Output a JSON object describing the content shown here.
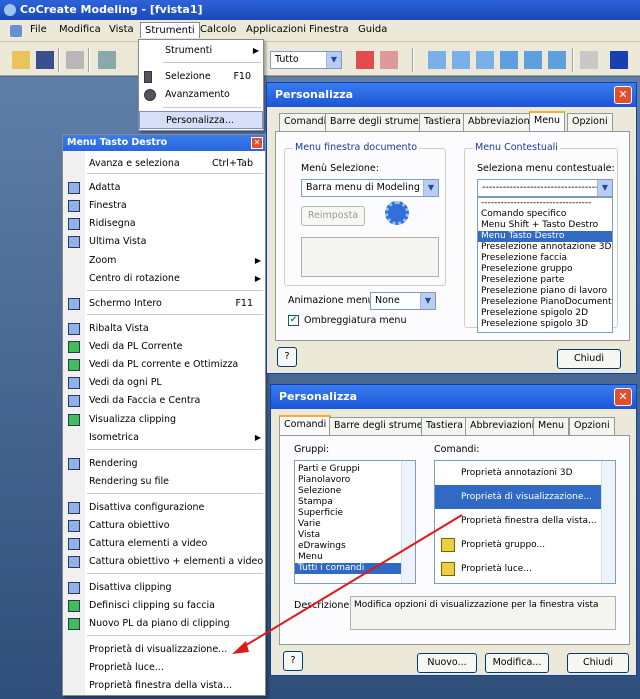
{
  "app": {
    "title": "CoCreate Modeling - [fvista1]"
  },
  "menubar": [
    "File",
    "Modifica",
    "Vista",
    "Strumenti",
    "Calcolo",
    "Applicazioni",
    "Finestra",
    "Guida"
  ],
  "toolbar": {
    "filter_value": "Tutto"
  },
  "strumenti_menu": {
    "items": [
      {
        "label": "Strumenti",
        "shortcut": "",
        "submenu": true
      },
      {
        "label": "Selezione",
        "shortcut": "F10",
        "submenu": false
      },
      {
        "label": "Avanzamento",
        "shortcut": "",
        "submenu": false
      },
      {
        "label": "Personalizza...",
        "shortcut": "",
        "submenu": false
      }
    ]
  },
  "context_menu": {
    "title": "Menu Tasto Destro",
    "items": [
      {
        "label": "Avanza e seleziona",
        "shortcut": "Ctrl+Tab"
      },
      {
        "label": "Adatta",
        "shortcut": ""
      },
      {
        "label": "Finestra",
        "shortcut": ""
      },
      {
        "label": "Ridisegna",
        "shortcut": ""
      },
      {
        "label": "Ultima Vista",
        "shortcut": ""
      },
      {
        "label": "Zoom",
        "shortcut": ""
      },
      {
        "label": "Centro di rotazione",
        "shortcut": ""
      },
      {
        "label": "Schermo Intero",
        "shortcut": "F11"
      },
      {
        "label": "Ribalta Vista",
        "shortcut": ""
      },
      {
        "label": "Vedi da PL Corrente",
        "shortcut": ""
      },
      {
        "label": "Vedi da PL corrente e Ottimizza",
        "shortcut": ""
      },
      {
        "label": "Vedi da ogni PL",
        "shortcut": ""
      },
      {
        "label": "Vedi da Faccia e Centra",
        "shortcut": ""
      },
      {
        "label": "Visualizza clipping",
        "shortcut": ""
      },
      {
        "label": "Isometrica",
        "shortcut": ""
      },
      {
        "label": "Rendering",
        "shortcut": ""
      },
      {
        "label": "Rendering su file",
        "shortcut": ""
      },
      {
        "label": "Disattiva configurazione",
        "shortcut": ""
      },
      {
        "label": "Cattura obiettivo",
        "shortcut": ""
      },
      {
        "label": "Cattura elementi a video",
        "shortcut": ""
      },
      {
        "label": "Cattura obiettivo + elementi a video",
        "shortcut": ""
      },
      {
        "label": "Disattiva clipping",
        "shortcut": ""
      },
      {
        "label": "Definisci clipping su faccia",
        "shortcut": ""
      },
      {
        "label": "Nuovo PL da piano di clipping",
        "shortcut": ""
      },
      {
        "label": "Proprietà di visualizzazione...",
        "shortcut": ""
      },
      {
        "label": "Proprietà luce...",
        "shortcut": ""
      },
      {
        "label": "Proprietà finestra della vista...",
        "shortcut": ""
      }
    ]
  },
  "dialog1": {
    "title": "Personalizza",
    "tabs": [
      "Comandi",
      "Barre degli strumenti",
      "Tastiera",
      "Abbreviazioni",
      "Menu",
      "Opzioni"
    ],
    "group_left": "Menu finestra documento",
    "menu_sel_label": "Menù Selezione:",
    "menu_sel_value": "Barra menu di Modeling",
    "reset_button": "Reimposta",
    "group_right": "Menu Contestuali",
    "context_sel_label": "Seleziona menu contestuale:",
    "context_sel_value": "----------------------------------",
    "context_list": [
      "----------------------------------",
      "Comando specifico",
      "Menu Shift + Tasto Destro",
      "Menu Tasto Destro",
      "Preselezione annotazione 3D",
      "Preselezione faccia",
      "Preselezione gruppo",
      "Preselezione parte",
      "Preselezione piano di lavoro",
      "Preselezione PianoDocumento",
      "Preselezione spigolo 2D",
      "Preselezione spigolo 3D"
    ],
    "anim_label": "Animazione menu:",
    "anim_value": "None",
    "shadow_label": "Ombreggiatura menu",
    "help": "?",
    "close_button": "Chiudi"
  },
  "dialog2": {
    "title": "Personalizza",
    "tabs": [
      "Comandi",
      "Barre degli strumenti",
      "Tastiera",
      "Abbreviazioni",
      "Menu",
      "Opzioni"
    ],
    "groups_label": "Gruppi:",
    "groups": [
      "Parti e Gruppi",
      "Pianolavoro",
      "Selezione",
      "Stampa",
      "Superficie",
      "Varie",
      "Vista",
      "eDrawings",
      "Menu",
      "Tutti i comandi"
    ],
    "commands_label": "Comandi:",
    "commands": [
      "Proprietà annotazioni 3D",
      "Proprietà di visualizzazione...",
      "Proprietà finestra della vista...",
      "Proprietà gruppo...",
      "Proprietà luce..."
    ],
    "desc_label": "Descrizione:",
    "desc_text": "Modifica opzioni di visualizzazione per la finestra vista",
    "help": "?",
    "new_button": "Nuovo...",
    "modify_button": "Modifica...",
    "close_button": "Chiudi"
  },
  "colors": {
    "title_blue": "#1c55d6",
    "selection": "#316ac5",
    "arrow": "#e01818"
  }
}
